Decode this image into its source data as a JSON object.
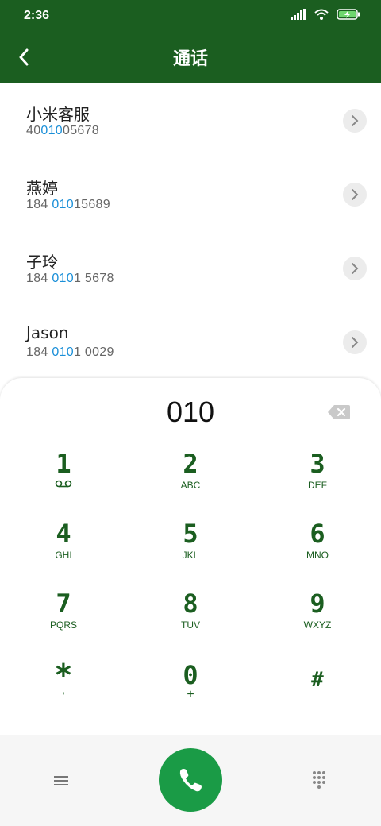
{
  "status": {
    "time": "2:36",
    "icons": [
      "signal-icon",
      "wifi-icon",
      "battery-charging-icon"
    ]
  },
  "header": {
    "title": "通话",
    "back_icon": "back-icon"
  },
  "contacts": [
    {
      "name": "小米客服",
      "number_pre": "40",
      "number_hl": "010",
      "number_post": "05678"
    },
    {
      "name": "燕婷",
      "number_pre": "184 ",
      "number_hl": "010",
      "number_post": "15689"
    },
    {
      "name": "子玲",
      "number_pre": "184 ",
      "number_hl": "010",
      "number_post": "1 5678"
    },
    {
      "name": "Jason",
      "number_pre": "184 ",
      "number_hl": "010",
      "number_post": "1 0029"
    }
  ],
  "dialpad": {
    "entered": "010",
    "keys": [
      {
        "digit": "1",
        "letters": ""
      },
      {
        "digit": "2",
        "letters": "ABC"
      },
      {
        "digit": "3",
        "letters": "DEF"
      },
      {
        "digit": "4",
        "letters": "GHI"
      },
      {
        "digit": "5",
        "letters": "JKL"
      },
      {
        "digit": "6",
        "letters": "MNO"
      },
      {
        "digit": "7",
        "letters": "PQRS"
      },
      {
        "digit": "8",
        "letters": "TUV"
      },
      {
        "digit": "9",
        "letters": "WXYZ"
      },
      {
        "digit": "*",
        "letters": ","
      },
      {
        "digit": "0",
        "letters": "+"
      },
      {
        "digit": "#",
        "letters": ""
      }
    ]
  },
  "colors": {
    "brand": "#1b5e20",
    "call": "#1a9b46",
    "highlight": "#1a8fd8"
  }
}
